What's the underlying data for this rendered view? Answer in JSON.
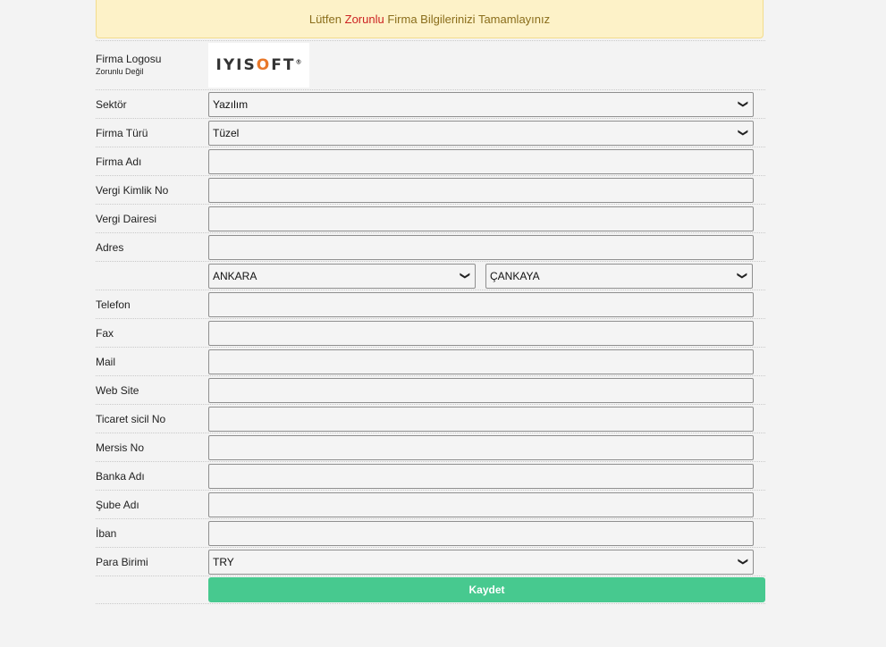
{
  "alert": {
    "prefix": "Lütfen",
    "required": "Zorunlu",
    "suffix": "Firma Bilgilerinizi Tamamlayınız"
  },
  "logo": {
    "label": "Firma Logosu",
    "sublabel": "Zorunlu Değil",
    "brand_part1": "IYIS",
    "brand_o": "O",
    "brand_part2": "FT",
    "brand_reg": "®"
  },
  "fields": {
    "sector": {
      "label": "Sektör",
      "value": "Yazılım"
    },
    "company_type": {
      "label": "Firma Türü",
      "value": "Tüzel"
    },
    "company_name": {
      "label": "Firma Adı",
      "value": ""
    },
    "tax_id": {
      "label": "Vergi Kimlik No",
      "value": ""
    },
    "tax_office": {
      "label": "Vergi Dairesi",
      "value": ""
    },
    "address": {
      "label": "Adres",
      "value": ""
    },
    "city": {
      "value": "ANKARA"
    },
    "district": {
      "value": "ÇANKAYA"
    },
    "phone": {
      "label": "Telefon",
      "value": ""
    },
    "fax": {
      "label": "Fax",
      "value": ""
    },
    "mail": {
      "label": "Mail",
      "value": ""
    },
    "website": {
      "label": "Web Site",
      "value": ""
    },
    "trade_registry": {
      "label": "Ticaret sicil No",
      "value": ""
    },
    "mersis": {
      "label": "Mersis No",
      "value": ""
    },
    "bank": {
      "label": "Banka Adı",
      "value": ""
    },
    "branch": {
      "label": "Şube Adı",
      "value": ""
    },
    "iban": {
      "label": "İban",
      "value": ""
    },
    "currency": {
      "label": "Para Birimi",
      "value": "TRY"
    }
  },
  "actions": {
    "save_label": "Kaydet"
  },
  "colors": {
    "alert_bg": "#fdf2c8",
    "alert_text": "#8a6d1b",
    "required_text": "#cc2222",
    "save_button": "#47c98f",
    "page_bg": "#f3f3f3"
  }
}
